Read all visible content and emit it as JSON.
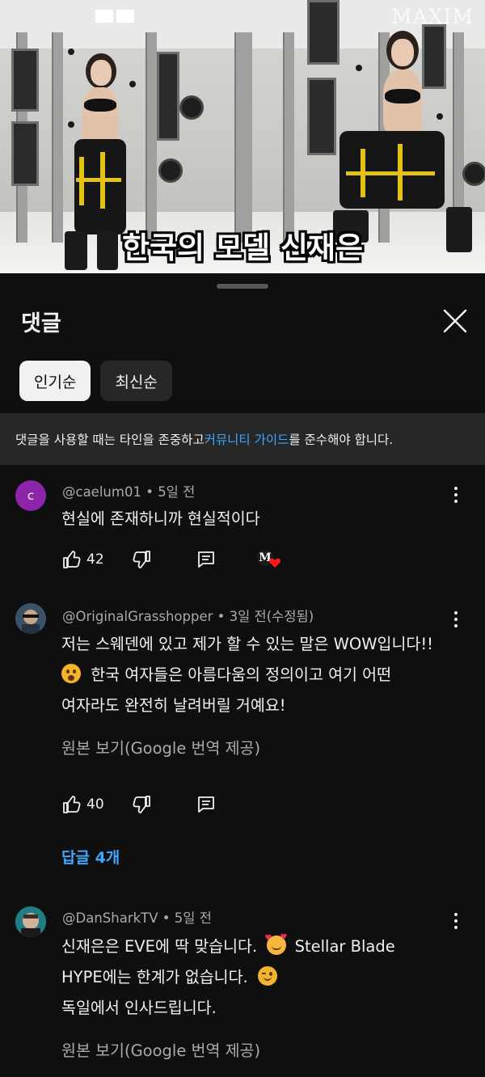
{
  "video": {
    "watermark": "MAXIM",
    "caption": "한국의 모델 신재은"
  },
  "sheet": {
    "title": "댓글",
    "chips": [
      "인기순",
      "최신순"
    ],
    "guidelines": {
      "before": "댓글을 사용할 때는 타인을 존중하고 ",
      "link": "커뮤니티 가이드",
      "after": "를 준수해야 합니다."
    }
  },
  "comments": [
    {
      "avatar_letter": "c",
      "author": "@caelum01",
      "time": "5일 전",
      "lines": [
        "현실에 존재하니까 현실적이다"
      ],
      "likes": "42",
      "creator_heart_letter": "M"
    },
    {
      "author": "@OriginalGrasshopper",
      "time": "3일 전(수정됨)",
      "lines": [
        "저는 스웨덴에 있고 제가 할 수 있는 말은 WOW입니다!!",
        "한국 여자들은 아름다움의 정의이고 여기 어떤",
        "여자라도 완전히 날려버릴 거예요!"
      ],
      "translate": "원본 보기(Google 번역 제공)",
      "likes": "40",
      "replies": "답글 4개"
    },
    {
      "author": "@DanSharkTV",
      "time": "5일 전",
      "lines": [
        "신재은은 EVE에 딱 맞습니다.",
        "Stellar Blade",
        "HYPE에는 한계가 없습니다.",
        "독일에서 인사드립니다."
      ],
      "translate": "원본 보기(Google 번역 제공)"
    }
  ],
  "colors": {
    "background": "#0f0f0f",
    "link": "#3ea6ff",
    "secondary_text": "#aaaaaa",
    "chip_inactive": "#272727",
    "avatar_c": "#8e24aa"
  },
  "icons": [
    "close-icon",
    "like-icon",
    "dislike-icon",
    "reply-icon",
    "more-vert-icon",
    "creator-heart-icon"
  ]
}
